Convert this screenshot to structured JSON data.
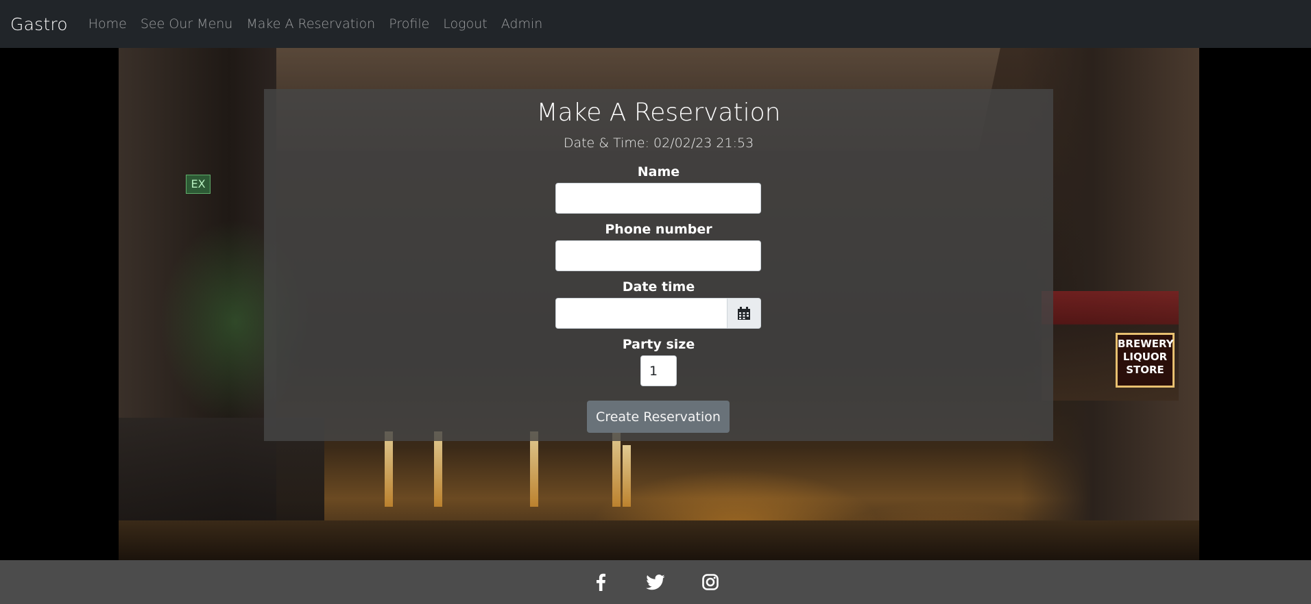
{
  "navbar": {
    "brand": "Gastro",
    "links": [
      {
        "label": "Home"
      },
      {
        "label": "See Our Menu"
      },
      {
        "label": "Make A Reservation"
      },
      {
        "label": "Profile"
      },
      {
        "label": "Logout"
      },
      {
        "label": "Admin"
      }
    ]
  },
  "form": {
    "title": "Make A Reservation",
    "datetime_text": "Date & Time: 02/02/23 21:53",
    "fields": {
      "name": {
        "label": "Name",
        "value": ""
      },
      "phone": {
        "label": "Phone number",
        "value": ""
      },
      "date_time": {
        "label": "Date time",
        "value": "",
        "icon": "calendar-icon"
      },
      "party_size": {
        "label": "Party size",
        "value": "1"
      }
    },
    "submit_label": "Create Reservation"
  },
  "footer": {
    "icons": [
      "facebook-icon",
      "twitter-icon",
      "instagram-icon"
    ]
  },
  "colors": {
    "navbar_bg": "#212529",
    "panel_bg": "#464646",
    "button_bg": "#6c757d",
    "footer_bg": "#4c4c4c"
  }
}
